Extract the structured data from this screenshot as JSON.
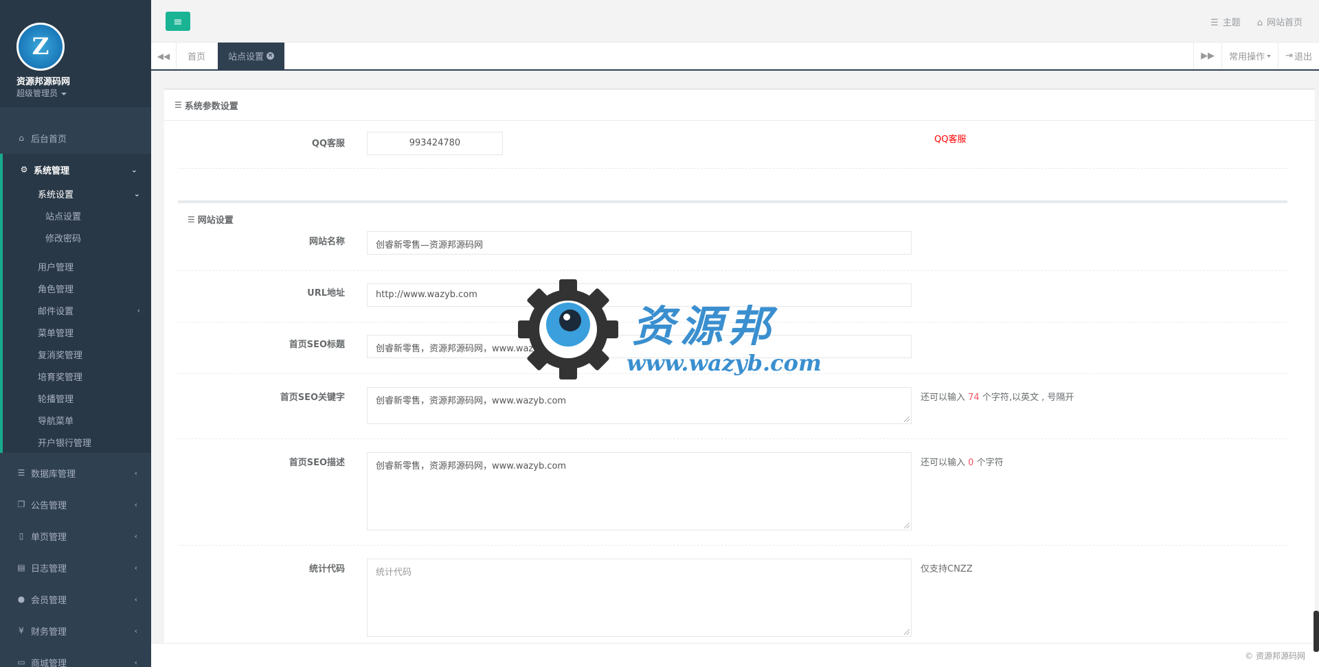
{
  "sidebar": {
    "site_name": "资源邦源码网",
    "role": "超级管理员",
    "home": "后台首页",
    "system_mgmt": "系统管理",
    "system_settings": "系统设置",
    "site_settings": "站点设置",
    "change_password": "修改密码",
    "items": [
      "用户管理",
      "角色管理",
      "邮件设置",
      "菜单管理",
      "复消奖管理",
      "培育奖管理",
      "轮播管理",
      "导航菜单",
      "开户银行管理"
    ],
    "groups": [
      "数据库管理",
      "公告管理",
      "单页管理",
      "日志管理",
      "会员管理",
      "财务管理",
      "商城管理"
    ]
  },
  "topbar": {
    "theme": "主题",
    "site_home": "网站首页"
  },
  "tabs": {
    "home": "首页",
    "active": "站点设置",
    "common_ops": "常用操作",
    "logout": "退出"
  },
  "panel": {
    "title": "系统参数设置",
    "qq": {
      "label": "QQ客服",
      "value": "993424780",
      "hint": "QQ客服"
    },
    "section2_title": "网站设置",
    "site_name": {
      "label": "网站名称",
      "value": "创睿新零售—资源邦源码网"
    },
    "url": {
      "label": "URL地址",
      "value": "http://www.wazyb.com"
    },
    "seo_title": {
      "label": "首页SEO标题",
      "value": "创睿新零售，资源邦源码网，www.wazyb.com"
    },
    "seo_keywords": {
      "label": "首页SEO关键字",
      "value": "创睿新零售，资源邦源码网，www.wazyb.com",
      "hint_pre": "还可以输入",
      "hint_num": "74",
      "hint_post": "个字符,以英文 , 号隔开"
    },
    "seo_desc": {
      "label": "首页SEO描述",
      "value": "创睿新零售，资源邦源码网，www.wazyb.com",
      "hint_pre": "还可以输入",
      "hint_num": "0",
      "hint_post": "个字符"
    },
    "stats": {
      "label": "统计代码",
      "placeholder": "统计代码",
      "hint": "仅支持CNZZ"
    }
  },
  "footer": {
    "copyright": "© 资源邦源码网"
  },
  "watermark": {
    "cn": "资源邦",
    "url": "www.wazyb.com"
  },
  "colors": {
    "accent": "#1ab394",
    "sidebar": "#2f4050",
    "link_blue": "#3a8fcf"
  }
}
